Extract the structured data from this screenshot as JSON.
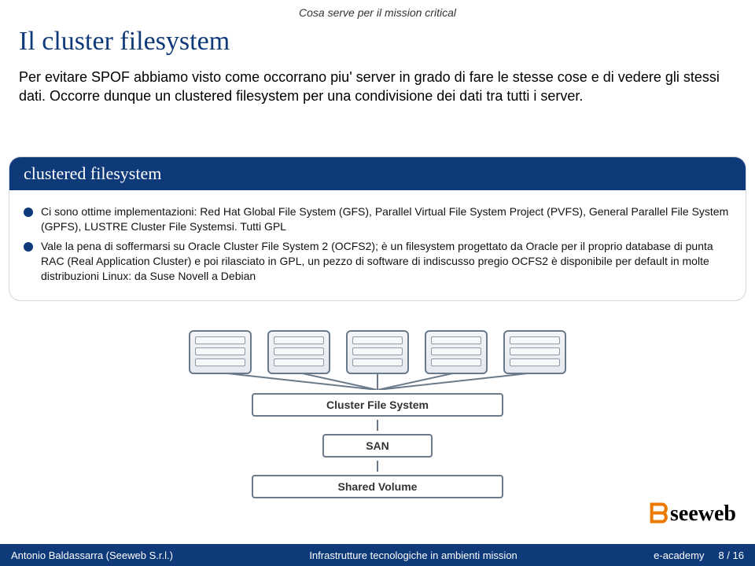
{
  "breadcrumb": "Cosa serve per il mission critical",
  "title": "Il cluster filesystem",
  "body_text": "Per evitare SPOF abbiamo visto come occorrano piu' server in grado di fare le stesse cose e di vedere gli stessi dati. Occorre dunque un clustered filesystem per una condivisione dei dati tra tutti i server.",
  "box": {
    "header": "clustered filesystem",
    "bullets": [
      "Ci sono ottime implementazioni: Red Hat Global File System (GFS), Parallel Virtual File System Project (PVFS), General Parallel File System (GPFS), LUSTRE Cluster File Systemsi. Tutti GPL",
      "Vale la pena di soffermarsi su Oracle Cluster File System 2 (OCFS2); è un filesystem progettato da Oracle per il proprio database di punta RAC (Real Application Cluster) e poi rilasciato in GPL, un pezzo di software di indiscusso pregio OCFS2 è disponibile per default in molte distribuzioni Linux: da Suse Novell a Debian"
    ]
  },
  "diagram": {
    "cfs": "Cluster File System",
    "san": "SAN",
    "shared": "Shared Volume"
  },
  "logo": "seeweb",
  "footer": {
    "author": "Antonio Baldassarra  (Seeweb S.r.l.)",
    "mid": "Infrastrutture tecnologiche in ambienti mission",
    "venue": "e-academy",
    "page": "8 / 16"
  }
}
